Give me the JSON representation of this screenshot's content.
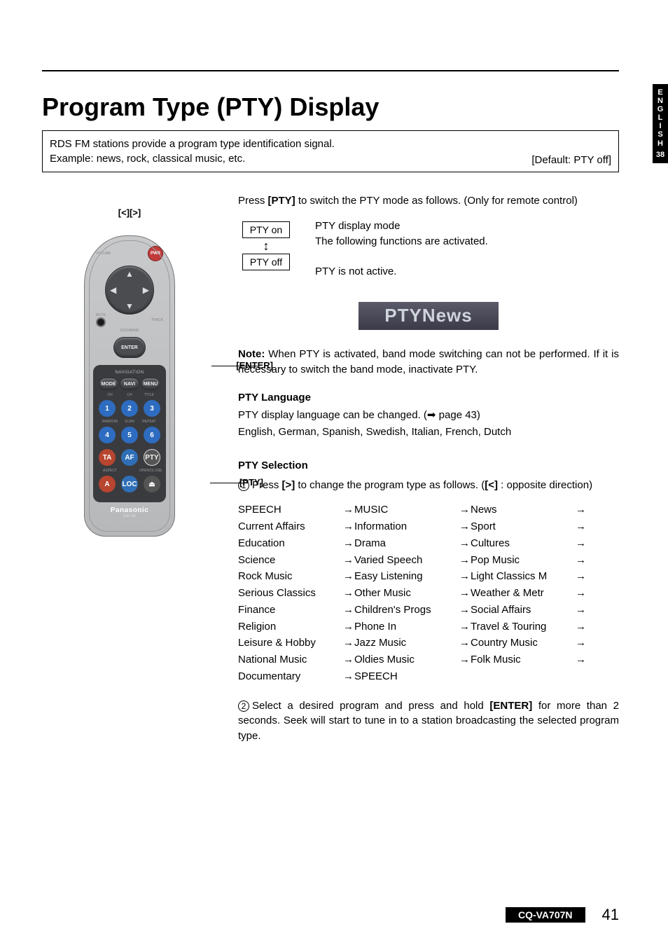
{
  "sideTab": {
    "lang": "ENGLISH",
    "section": "38"
  },
  "title": "Program Type (PTY) Display",
  "intro": {
    "line1": "RDS FM stations provide a program type identification signal.",
    "line2": "Example: news, rock, classical music, etc.",
    "default": "[Default: PTY off]"
  },
  "remoteLabels": {
    "track": "[<][>]",
    "enter": "[ENTER]",
    "pty": "[PTY]"
  },
  "remote": {
    "pwr": "PWR",
    "mute": "MUTE",
    "volume": "VOLUME",
    "trackLab": "TRACK",
    "discBand": "DISC/BAND",
    "enter": "ENTER",
    "navigation": "NAVIGATION",
    "mode": "MODE",
    "navi": "NAVI",
    "menu": "MENU",
    "ch_dn": "CH",
    "ch_up": "CH",
    "title": "TITLE",
    "n1": "1",
    "n2": "2",
    "n3": "3",
    "n4": "4",
    "n5": "5",
    "n6": "6",
    "random": "RANDOM",
    "scan": "SCAN",
    "repeat": "REPEAT",
    "ta": "TA",
    "af": "AF",
    "ptyBtn": "PTY",
    "aspect": "ASPECT",
    "openclose": "OPEN/CLOSE",
    "a": "A",
    "loc": "LOC",
    "eject": "⏏",
    "brand": "Panasonic",
    "brandSub": "Car AV"
  },
  "body": {
    "pressPty_a": "Press ",
    "pressPty_b": "[PTY]",
    "pressPty_c": " to switch the PTY mode as follows. (Only for remote control)",
    "ptyOn": "PTY on",
    "ptyOff": "PTY off",
    "ptyOnDesc1": "PTY display mode",
    "ptyOnDesc2": "The following functions are activated.",
    "ptyOffDesc": "PTY is not active.",
    "newsBadge": "PTYNews",
    "noteLabel": "Note:",
    "noteText": " When PTY is activated, band mode switching can not be performed. If it is necessary to switch the band mode, inactivate PTY.",
    "langHead": "PTY Language",
    "langLine1_a": "PTY display language can be changed. (",
    "langLine1_b": " page 43)",
    "langLine2": "English, German, Spanish, Swedish, Italian, French, Dutch",
    "selHead": "PTY Selection",
    "step1_a": "Press ",
    "step1_b": "[>]",
    "step1_c": " to change the program type as follows. (",
    "step1_d": "[<]",
    "step1_e": " : opposite direction)",
    "step2_a": "Select a desired program and press and hold ",
    "step2_b": "[ENTER]",
    "step2_c": " for more than 2 seconds. Seek will start to tune in to a station broadcasting the selected program type."
  },
  "ptyList": [
    [
      "SPEECH",
      "MUSIC",
      "News"
    ],
    [
      "Current Affairs",
      "Information",
      "Sport"
    ],
    [
      "Education",
      "Drama",
      "Cultures"
    ],
    [
      "Science",
      "Varied Speech",
      "Pop Music"
    ],
    [
      "Rock Music",
      "Easy Listening",
      "Light Classics M"
    ],
    [
      "Serious Classics",
      "Other Music",
      "Weather & Metr"
    ],
    [
      "Finance",
      "Children's Progs",
      "Social Affairs"
    ],
    [
      "Religion",
      "Phone In",
      "Travel & Touring"
    ],
    [
      "Leisure & Hobby",
      "Jazz Music",
      "Country Music"
    ],
    [
      "National Music",
      "Oldies Music",
      "Folk Music"
    ],
    [
      "Documentary",
      "SPEECH",
      ""
    ]
  ],
  "footer": {
    "model": "CQ-VA707N",
    "page": "41"
  }
}
